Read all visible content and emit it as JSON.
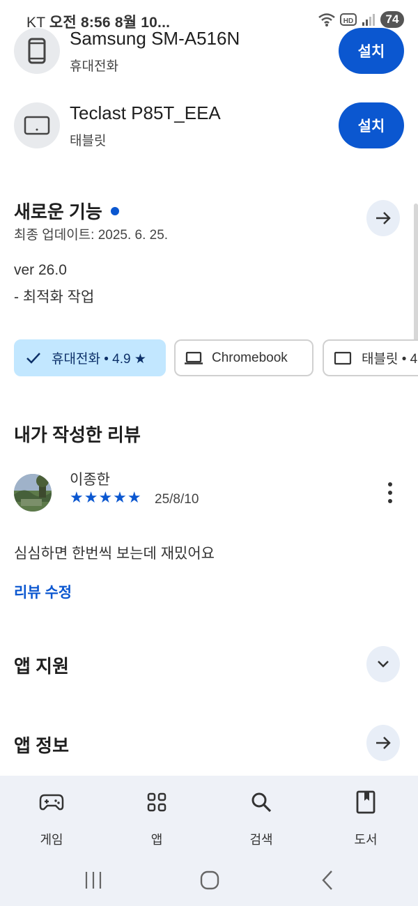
{
  "status_bar": {
    "carrier": "KT",
    "time": "오전 8:56",
    "date": "8월 10...",
    "hd_label": "HD",
    "battery": "74"
  },
  "devices": [
    {
      "name": "Samsung SM-A516N",
      "type": "휴대전화",
      "icon": "phone-icon",
      "install_label": "설치"
    },
    {
      "name": "Teclast P85T_EEA",
      "type": "태블릿",
      "icon": "tablet-icon",
      "install_label": "설치"
    }
  ],
  "whats_new": {
    "title": "새로운 기능",
    "updated": "최종 업데이트: 2025. 6. 25.",
    "notes": [
      "ver 26.0",
      "- 최적화 작업"
    ]
  },
  "device_chips": [
    {
      "label": "휴대전화 • 4.9 ★",
      "icon": "check-icon",
      "selected": true
    },
    {
      "label": "Chromebook",
      "icon": "laptop-icon",
      "selected": false
    },
    {
      "label": "태블릿 • 4",
      "icon": "tablet-icon",
      "selected": false
    }
  ],
  "my_review": {
    "title": "내가 작성한 리뷰",
    "reviewer": "이종한",
    "stars": "★★★★★",
    "rating": 5,
    "date": "25/8/10",
    "text": "심심하면 한번씩 보는데 재밌어요",
    "edit_label": "리뷰 수정"
  },
  "sections": {
    "app_support": "앱 지원",
    "app_info": "앱 정보"
  },
  "bottom_nav": [
    {
      "label": "게임",
      "icon": "gamepad-icon"
    },
    {
      "label": "앱",
      "icon": "apps-grid-icon"
    },
    {
      "label": "검색",
      "icon": "search-icon"
    },
    {
      "label": "도서",
      "icon": "book-icon"
    }
  ],
  "colors": {
    "accent": "#0b57d0",
    "chip_selected_bg": "#c2e7ff",
    "nav_bg": "#eef1f7",
    "icon_circle_bg": "#e8eaed"
  }
}
